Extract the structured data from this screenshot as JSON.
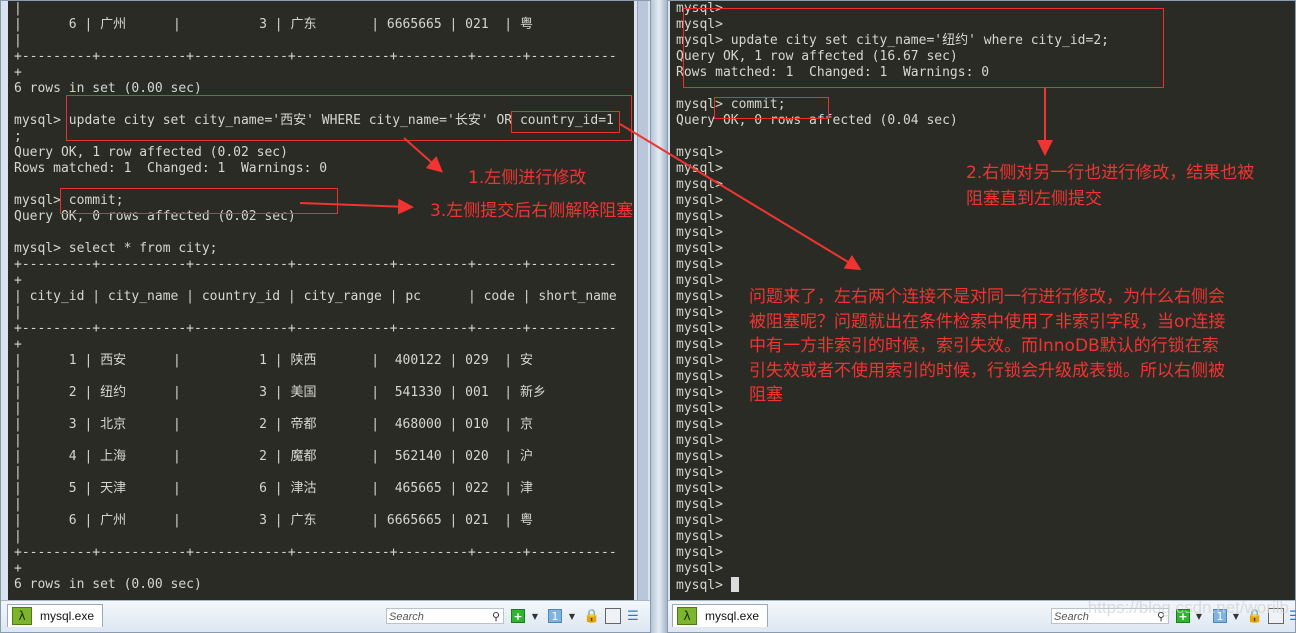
{
  "left_terminal": {
    "lines": [
      "|",
      "|      6 | 广州      |          3 | 广东       | 6665665 | 021  | 粤",
      "|",
      "+---------+-----------+------------+------------+---------+------+-----------",
      "+",
      "6 rows in set (0.00 sec)",
      "",
      "mysql> update city set city_name='西安' WHERE city_name='长安' OR country_id=1",
      ";",
      "Query OK, 1 row affected (0.02 sec)",
      "Rows matched: 1  Changed: 1  Warnings: 0",
      "",
      "mysql> commit;",
      "Query OK, 0 rows affected (0.02 sec)",
      "",
      "mysql> select * from city;",
      "+---------+-----------+------------+------------+---------+------+-----------",
      "+",
      "| city_id | city_name | country_id | city_range | pc      | code | short_name",
      "|",
      "+---------+-----------+------------+------------+---------+------+-----------",
      "+",
      "|      1 | 西安      |          1 | 陕西       |  400122 | 029  | 安",
      "|",
      "|      2 | 纽约      |          3 | 美国       |  541330 | 001  | 新乡",
      "|",
      "|      3 | 北京      |          2 | 帝都       |  468000 | 010  | 京",
      "|",
      "|      4 | 上海      |          2 | 魔都       |  562140 | 020  | 沪",
      "|",
      "|      5 | 天津      |          6 | 津沽       |  465665 | 022  | 津",
      "|",
      "|      6 | 广州      |          3 | 广东       | 6665665 | 021  | 粤",
      "|",
      "+---------+-----------+------------+------------+---------+------+-----------",
      "+",
      "6 rows in set (0.00 sec)"
    ],
    "table": {
      "columns": [
        "city_id",
        "city_name",
        "country_id",
        "city_range",
        "pc",
        "code",
        "short_name"
      ],
      "rows": [
        [
          "1",
          "西安",
          "1",
          "陕西",
          "400122",
          "029",
          "安"
        ],
        [
          "2",
          "纽约",
          "3",
          "美国",
          "541330",
          "001",
          "新乡"
        ],
        [
          "3",
          "北京",
          "2",
          "帝都",
          "468000",
          "010",
          "京"
        ],
        [
          "4",
          "上海",
          "2",
          "魔都",
          "562140",
          "020",
          "沪"
        ],
        [
          "5",
          "天津",
          "6",
          "津沽",
          "465665",
          "022",
          "津"
        ],
        [
          "6",
          "广州",
          "3",
          "广东",
          "6665665",
          "021",
          "粤"
        ]
      ]
    },
    "tab_label": "mysql.exe",
    "search_placeholder": "Search"
  },
  "right_terminal": {
    "lines": [
      "mysql>",
      "mysql>",
      "mysql> update city set city_name='纽约' where city_id=2;",
      "Query OK, 1 row affected (16.67 sec)",
      "Rows matched: 1  Changed: 1  Warnings: 0",
      "",
      "mysql> commit;",
      "Query OK, 0 rows affected (0.04 sec)",
      "",
      "mysql>",
      "mysql>",
      "mysql>",
      "mysql>",
      "mysql>",
      "mysql>",
      "mysql>",
      "mysql>",
      "mysql>",
      "mysql>",
      "mysql>",
      "mysql>",
      "mysql>",
      "mysql>",
      "mysql>",
      "mysql>",
      "mysql>",
      "mysql>",
      "mysql>",
      "mysql>",
      "mysql>",
      "mysql>",
      "mysql>",
      "mysql>",
      "mysql>",
      "mysql>",
      "mysql>",
      "mysql>"
    ],
    "prompt": "mysql> ",
    "tab_label": "mysql.exe",
    "search_placeholder": "Search"
  },
  "annotations": {
    "step1": "1.左侧进行修改",
    "step2_line1": "2.右侧对另一行也进行修改，结果也被",
    "step2_line2": "阻塞直到左侧提交",
    "step3": "3.左侧提交后右侧解除阻塞",
    "explanation_lines": [
      "问题来了，左右两个连接不是对同一行进行修改，为什么右侧会",
      "被阻塞呢？问题就出在条件检索中使用了非索引字段，当or连接",
      "中有一方非索引的时候，索引失效。而InnoDB默认的行锁在索",
      "引失效或者不使用索引的时候，行锁会升级成表锁。所以右侧被",
      "阻塞"
    ],
    "color": "#f03431"
  },
  "icons": {
    "console": "λ",
    "search": "⚲",
    "new_console": "+",
    "dropdown": "▼",
    "tab_number": "1",
    "lock": "🔒",
    "menu": "☰"
  },
  "watermark": "https://blog.csdn.net/worilb"
}
